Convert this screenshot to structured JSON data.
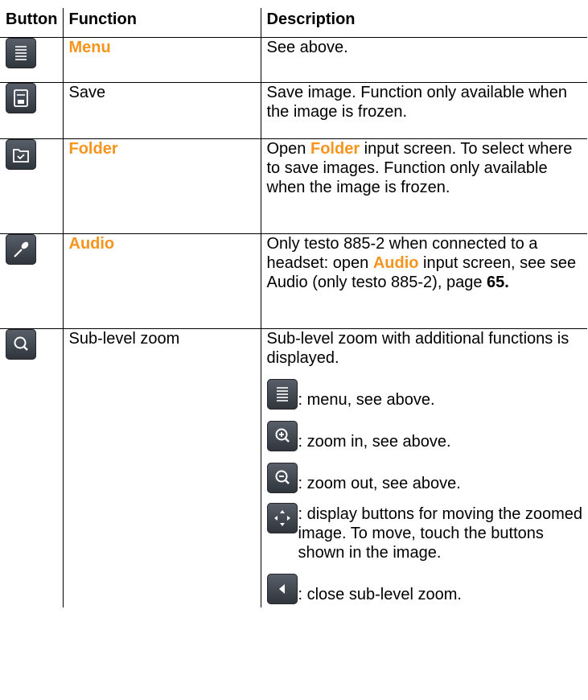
{
  "table": {
    "headers": [
      "Button",
      "Function",
      "Description"
    ],
    "rows": [
      {
        "icon": "menu-icon",
        "function": "Menu",
        "description": "See above."
      },
      {
        "icon": "save-icon",
        "function": "Save",
        "description": "Save image. Function only available when the image is frozen."
      },
      {
        "icon": "folder-icon",
        "function": "Folder",
        "desc_part1": "Open ",
        "desc_bold": "Folder",
        "desc_part2": " input screen. To select where to save images. Function only available when the image is frozen."
      },
      {
        "icon": "microphone-icon",
        "function": "Audio",
        "desc_part1": "Only testo 885-2 when connected to a headset: open ",
        "desc_bold": "Audio",
        "desc_part2": " input screen, see see Audio (only testo 885-2), page ",
        "desc_page": "65."
      },
      {
        "icon": "zoom-icon",
        "function": "Sub-level zoom",
        "description": "Sub-level zoom with additional functions is displayed.",
        "sub_items": [
          {
            "icon": "menu-icon",
            "text": ": menu, see above."
          },
          {
            "icon": "zoom-in-icon",
            "text": ": zoom in, see above."
          },
          {
            "icon": "zoom-out-icon",
            "text": ": zoom out, see above."
          },
          {
            "icon": "move-arrows-icon",
            "text": ": display buttons for moving the zoomed image. To move, touch the buttons shown in the image."
          },
          {
            "icon": "close-arrow-icon",
            "text": ": close sub-level zoom."
          }
        ]
      }
    ]
  },
  "colors": {
    "highlight": "#f7941d",
    "icon_bg": "#3f454d"
  }
}
